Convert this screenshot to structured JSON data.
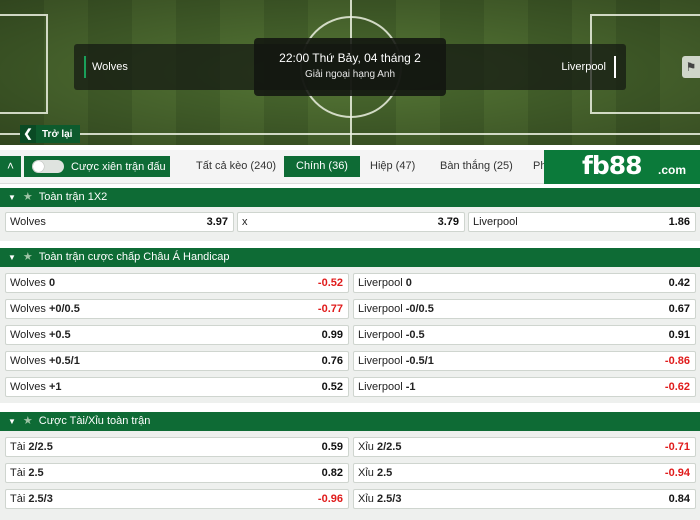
{
  "match": {
    "home": "Wolves",
    "away": "Liverpool",
    "datetime": "22:00 Thứ Bảy, 04 tháng 2",
    "league": "Giải ngoại hạng Anh",
    "back_label": "Trở lại"
  },
  "tabs_bar": {
    "combo_label": "Cược xiên trận đấu",
    "tabs": [
      "Tất cả kèo (240)",
      "Chính (36)",
      "Hiệp (47)",
      "Bàn thắng (25)",
      "Ph"
    ],
    "active_tab": "Chính (36)"
  },
  "brand": {
    "logo_text": "fb88",
    "logo_domain": ".com"
  },
  "sections": {
    "match_1x2": {
      "title": "Toàn trận 1X2",
      "cells": [
        {
          "name": "Wolves",
          "odd": "3.97"
        },
        {
          "name": "x",
          "odd": "3.79"
        },
        {
          "name": "Liverpool",
          "odd": "1.86"
        }
      ]
    },
    "asian_handicap": {
      "title": "Toàn trận cược chấp Châu Á Handicap",
      "rows": [
        {
          "home_name": "Wolves",
          "home_line": "0",
          "home_odd": "-0.52",
          "away_name": "Liverpool",
          "away_line": "0",
          "away_odd": "0.42"
        },
        {
          "home_name": "Wolves",
          "home_line": "+0/0.5",
          "home_odd": "-0.77",
          "away_name": "Liverpool",
          "away_line": "-0/0.5",
          "away_odd": "0.67"
        },
        {
          "home_name": "Wolves",
          "home_line": "+0.5",
          "home_odd": "0.99",
          "away_name": "Liverpool",
          "away_line": "-0.5",
          "away_odd": "0.91"
        },
        {
          "home_name": "Wolves",
          "home_line": "+0.5/1",
          "home_odd": "0.76",
          "away_name": "Liverpool",
          "away_line": "-0.5/1",
          "away_odd": "-0.86"
        },
        {
          "home_name": "Wolves",
          "home_line": "+1",
          "home_odd": "0.52",
          "away_name": "Liverpool",
          "away_line": "-1",
          "away_odd": "-0.62"
        }
      ]
    },
    "over_under": {
      "title": "Cược Tài/Xỉu toàn trận",
      "rows": [
        {
          "over_name": "Tài",
          "over_line": "2/2.5",
          "over_odd": "0.59",
          "under_name": "Xỉu",
          "under_line": "2/2.5",
          "under_odd": "-0.71"
        },
        {
          "over_name": "Tài",
          "over_line": "2.5",
          "over_odd": "0.82",
          "under_name": "Xỉu",
          "under_line": "2.5",
          "under_odd": "-0.94"
        },
        {
          "over_name": "Tài",
          "over_line": "2.5/3",
          "over_odd": "-0.96",
          "under_name": "Xỉu",
          "under_line": "2.5/3",
          "under_odd": "0.84"
        }
      ]
    }
  },
  "colors": {
    "primary_green": "#0e6b35",
    "negative_odd": "#e01b1b"
  }
}
